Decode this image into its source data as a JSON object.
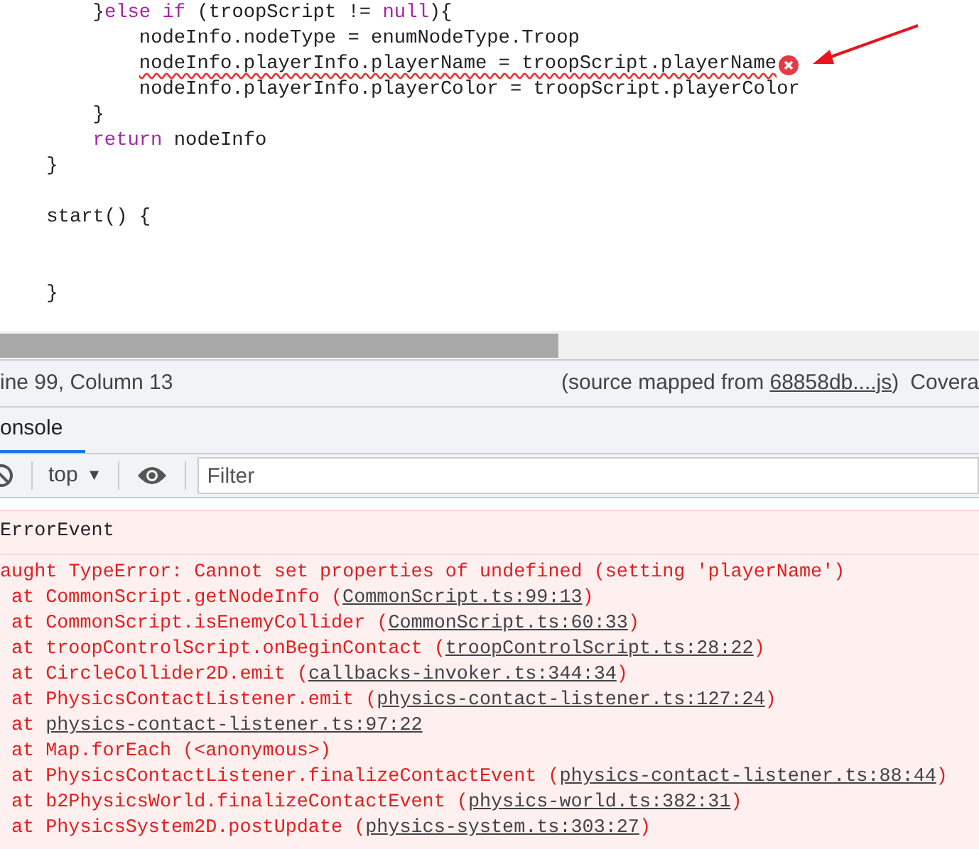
{
  "editor": {
    "lines": [
      {
        "kind": "code",
        "segments": [
          {
            "text": "        }",
            "kind": "plain"
          },
          {
            "text": "else if",
            "kind": "keyword"
          },
          {
            "text": " (troopScript != ",
            "kind": "plain"
          },
          {
            "text": "null",
            "kind": "keyword"
          },
          {
            "text": "){",
            "kind": "plain"
          }
        ]
      },
      {
        "kind": "code",
        "segments": [
          {
            "text": "            nodeInfo.nodeType = enumNodeType.Troop",
            "kind": "plain"
          }
        ]
      },
      {
        "kind": "code",
        "error": true,
        "segments": [
          {
            "text": "            nodeInfo.playerInfo.playerName = troopScript.playerName",
            "kind": "plain"
          }
        ]
      },
      {
        "kind": "code",
        "segments": [
          {
            "text": "            nodeInfo.playerInfo.playerColor = troopScript.playerColor",
            "kind": "plain"
          }
        ]
      },
      {
        "kind": "code",
        "segments": [
          {
            "text": "        }",
            "kind": "plain"
          }
        ]
      },
      {
        "kind": "code",
        "segments": [
          {
            "text": "        return",
            "kind": "keyword"
          },
          {
            "text": " nodeInfo",
            "kind": "plain"
          }
        ]
      },
      {
        "kind": "code",
        "segments": [
          {
            "text": "    }",
            "kind": "plain"
          }
        ]
      },
      {
        "kind": "blank"
      },
      {
        "kind": "code",
        "segments": [
          {
            "text": "    start() {",
            "kind": "plain"
          }
        ]
      },
      {
        "kind": "blank"
      },
      {
        "kind": "blank"
      },
      {
        "kind": "code",
        "segments": [
          {
            "text": "    }",
            "kind": "plain"
          }
        ]
      }
    ]
  },
  "status_bar": {
    "position": "ine 99, Column 13",
    "source_prefix": "(source mapped from ",
    "source_link": "68858db....js",
    "source_suffix": ")",
    "coverage": "Covera"
  },
  "tabs": [
    {
      "label": "onsole",
      "selected": true
    }
  ],
  "console_toolbar": {
    "context": "top",
    "context_caret": "▼",
    "filter": {
      "placeholder": "Filter"
    }
  },
  "messages": [
    {
      "kind": "event",
      "text": "ErrorEvent"
    },
    {
      "kind": "error",
      "text": "aught TypeError: Cannot set properties of undefined (setting 'playerName')",
      "frames": [
        {
          "prefix": "at CommonScript.getNodeInfo (",
          "link": "CommonScript.ts:99:13",
          "suffix": ")"
        },
        {
          "prefix": "at CommonScript.isEnemyCollider (",
          "link": "CommonScript.ts:60:33",
          "suffix": ")"
        },
        {
          "prefix": "at troopControlScript.onBeginContact (",
          "link": "troopControlScript.ts:28:22",
          "suffix": ")"
        },
        {
          "prefix": "at CircleCollider2D.emit (",
          "link": "callbacks-invoker.ts:344:34",
          "suffix": ")"
        },
        {
          "prefix": "at PhysicsContactListener.emit (",
          "link": "physics-contact-listener.ts:127:24",
          "suffix": ")"
        },
        {
          "prefix": "at ",
          "link": "physics-contact-listener.ts:97:22"
        },
        {
          "prefix": "at Map.forEach (<anonymous>)"
        },
        {
          "prefix": "at PhysicsContactListener.finalizeContactEvent (",
          "link": "physics-contact-listener.ts:88:44",
          "suffix": ")"
        },
        {
          "prefix": "at b2PhysicsWorld.finalizeContactEvent (",
          "link": "physics-world.ts:382:31",
          "suffix": ")"
        },
        {
          "prefix": "at PhysicsSystem2D.postUpdate (",
          "link": "physics-system.ts:303:27",
          "suffix": ")"
        }
      ]
    }
  ]
}
